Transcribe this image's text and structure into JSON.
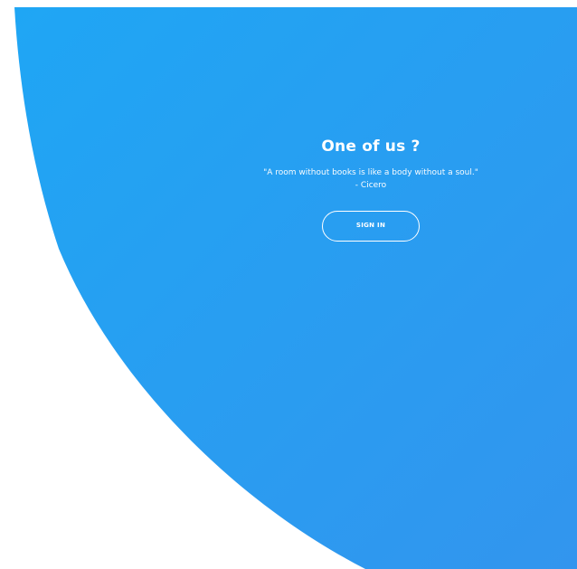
{
  "panel": {
    "title": "One of us ?",
    "quote": "\"A room without books is like a body without a soul.\"",
    "author": "- Cicero",
    "signin_label": "SIGN IN"
  },
  "colors": {
    "gradient_start": "#1fa6f4",
    "gradient_end": "#3295ee",
    "background": "#ffffff",
    "text": "#ffffff"
  }
}
